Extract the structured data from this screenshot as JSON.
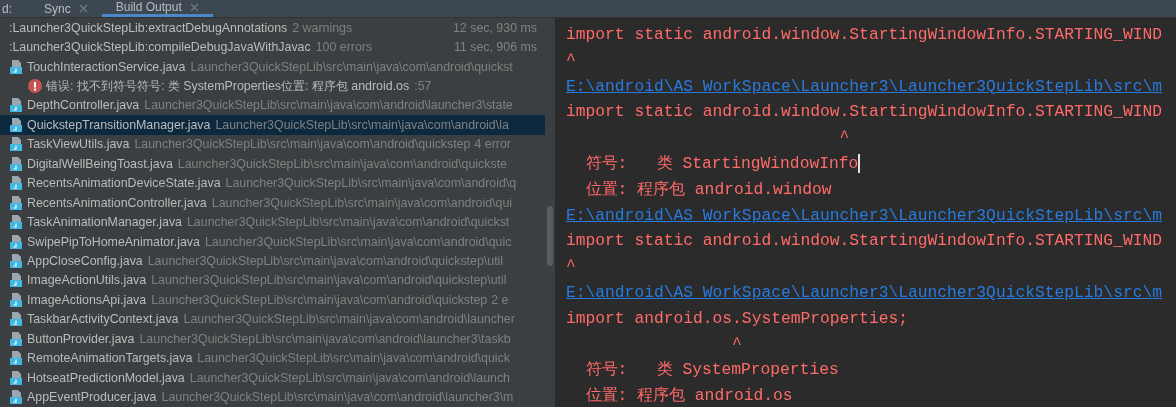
{
  "tabs": [
    {
      "label": "d:",
      "selected": false,
      "closable": false
    },
    {
      "label": "Sync",
      "selected": false,
      "closable": true
    },
    {
      "label": "Build Output",
      "selected": true,
      "closable": true
    }
  ],
  "build_tree": [
    {
      "kind": "task",
      "selected": false,
      "name": ":Launcher3QuickStepLib:extractDebugAnnotations",
      "summary": "2 warnings",
      "time": "12 sec, 930 ms"
    },
    {
      "kind": "task",
      "selected": false,
      "name": ":Launcher3QuickStepLib:compileDebugJavaWithJavac",
      "summary": "100 errors",
      "time": "11 sec, 906 ms"
    },
    {
      "kind": "file",
      "selected": false,
      "name": "TouchInteractionService.java",
      "path": "Launcher3QuickStepLib\\src\\main\\java\\com\\android\\quickst",
      "children": [
        {
          "kind": "error",
          "selected": false,
          "name": "错误: 找不到符号符号:   类 SystemProperties位置: 程序包 android.os",
          "line": ":57"
        }
      ]
    },
    {
      "kind": "file",
      "selected": false,
      "name": "DepthController.java",
      "path": "Launcher3QuickStepLib\\src\\main\\java\\com\\android\\launcher3\\state"
    },
    {
      "kind": "file",
      "selected": true,
      "name": "QuickstepTransitionManager.java",
      "path": "Launcher3QuickStepLib\\src\\main\\java\\com\\android\\la"
    },
    {
      "kind": "file",
      "selected": false,
      "name": "TaskViewUtils.java",
      "path": "Launcher3QuickStepLib\\src\\main\\java\\com\\android\\quickstep",
      "summary": "4 error"
    },
    {
      "kind": "file",
      "selected": false,
      "name": "DigitalWellBeingToast.java",
      "path": "Launcher3QuickStepLib\\src\\main\\java\\com\\android\\quickste"
    },
    {
      "kind": "file",
      "selected": false,
      "name": "RecentsAnimationDeviceState.java",
      "path": "Launcher3QuickStepLib\\src\\main\\java\\com\\android\\q"
    },
    {
      "kind": "file",
      "selected": false,
      "name": "RecentsAnimationController.java",
      "path": "Launcher3QuickStepLib\\src\\main\\java\\com\\android\\qui"
    },
    {
      "kind": "file",
      "selected": false,
      "name": "TaskAnimationManager.java",
      "path": "Launcher3QuickStepLib\\src\\main\\java\\com\\android\\quickst"
    },
    {
      "kind": "file",
      "selected": false,
      "name": "SwipePipToHomeAnimator.java",
      "path": "Launcher3QuickStepLib\\src\\main\\java\\com\\android\\quic"
    },
    {
      "kind": "file",
      "selected": false,
      "name": "AppCloseConfig.java",
      "path": "Launcher3QuickStepLib\\src\\main\\java\\com\\android\\quickstep\\util"
    },
    {
      "kind": "file",
      "selected": false,
      "name": "ImageActionUtils.java",
      "path": "Launcher3QuickStepLib\\src\\main\\java\\com\\android\\quickstep\\util"
    },
    {
      "kind": "file",
      "selected": false,
      "name": "ImageActionsApi.java",
      "path": "Launcher3QuickStepLib\\src\\main\\java\\com\\android\\quickstep",
      "summary": "2 e"
    },
    {
      "kind": "file",
      "selected": false,
      "name": "TaskbarActivityContext.java",
      "path": "Launcher3QuickStepLib\\src\\main\\java\\com\\android\\launcher"
    },
    {
      "kind": "file",
      "selected": false,
      "name": "ButtonProvider.java",
      "path": "Launcher3QuickStepLib\\src\\main\\java\\com\\android\\launcher3\\taskb"
    },
    {
      "kind": "file",
      "selected": false,
      "name": "RemoteAnimationTargets.java",
      "path": "Launcher3QuickStepLib\\src\\main\\java\\com\\android\\quick"
    },
    {
      "kind": "file",
      "selected": false,
      "name": "HotseatPredictionModel.java",
      "path": "Launcher3QuickStepLib\\src\\main\\java\\com\\android\\launch"
    },
    {
      "kind": "file",
      "selected": false,
      "name": "AppEventProducer.java",
      "path": "Launcher3QuickStepLib\\src\\main\\java\\com\\android\\launcher3\\m"
    }
  ],
  "console": [
    {
      "kind": "text",
      "text": "import static android.window.StartingWindowInfo.STARTING_WIND",
      "cursor": false
    },
    {
      "kind": "text",
      "text": "^",
      "cursor": false
    },
    {
      "kind": "link",
      "text": "E:\\android\\AS_WorkSpace\\Launcher3\\Launcher3QuickStepLib\\src\\m",
      "cursor": false
    },
    {
      "kind": "text",
      "text": "import static android.window.StartingWindowInfo.STARTING_WIND",
      "cursor": false
    },
    {
      "kind": "text",
      "text": "                            ^",
      "cursor": false
    },
    {
      "kind": "text",
      "text": "  符号:   类 StartingWindowInfo",
      "cursor": true
    },
    {
      "kind": "text",
      "text": "  位置: 程序包 android.window",
      "cursor": false
    },
    {
      "kind": "link",
      "text": "E:\\android\\AS_WorkSpace\\Launcher3\\Launcher3QuickStepLib\\src\\m",
      "cursor": false
    },
    {
      "kind": "text",
      "text": "import static android.window.StartingWindowInfo.STARTING_WIND",
      "cursor": false
    },
    {
      "kind": "text",
      "text": "^",
      "cursor": false
    },
    {
      "kind": "link",
      "text": "E:\\android\\AS_WorkSpace\\Launcher3\\Launcher3QuickStepLib\\src\\m",
      "cursor": false
    },
    {
      "kind": "text",
      "text": "import android.os.SystemProperties;",
      "cursor": false
    },
    {
      "kind": "text",
      "text": "                 ^",
      "cursor": false
    },
    {
      "kind": "text",
      "text": "  符号:   类 SystemProperties",
      "cursor": false
    },
    {
      "kind": "text",
      "text": "  位置: 程序包 android.os",
      "cursor": false
    }
  ]
}
